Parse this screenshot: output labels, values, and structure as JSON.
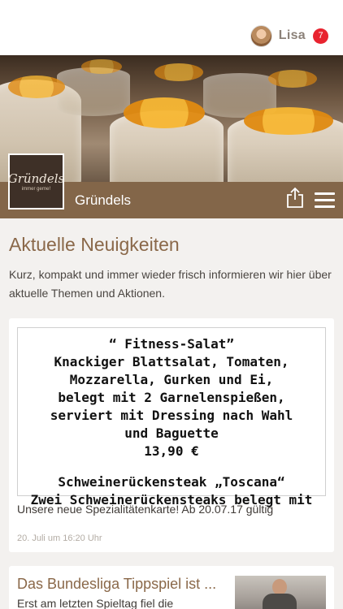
{
  "header": {
    "user_name": "Lisa",
    "notification_count": "7"
  },
  "brand": {
    "title": "Gründels",
    "logo_text": "Gründels",
    "logo_tagline": "immer gerne!"
  },
  "news": {
    "title": "Aktuelle Neuigkeiten",
    "intro": "Kurz, kompakt und immer wieder frisch informieren wir hier über aktuelle Themen und Aktionen."
  },
  "post1": {
    "image_lines": [
      "“ Fitness-Salat”",
      "Knackiger Blattsalat, Tomaten,",
      "Mozzarella, Gurken und Ei,",
      "belegt mit 2 Garnelenspießen,",
      "serviert mit Dressing nach Wahl",
      "und Baguette",
      "13,90 €",
      "Schweinerückensteak „Toscana“",
      "Zwei Schweinerückensteaks belegt mit"
    ],
    "caption": "Unsere neue Spezialitätenkarte! Ab 20.07.17 gültig",
    "date": "20. Juli um 16:20 Uhr"
  },
  "post2": {
    "title": "Das Bundesliga Tippspiel ist ...",
    "text": "Erst am letzten Spieltag fiel die"
  },
  "icons": {
    "share": "share-icon",
    "menu": "hamburger-menu-icon",
    "avatar": "user-avatar"
  },
  "colors": {
    "brand_brown": "#836649",
    "title_brown": "#8a6849",
    "badge_red": "#e8232f",
    "background": "#f3f1ef"
  }
}
